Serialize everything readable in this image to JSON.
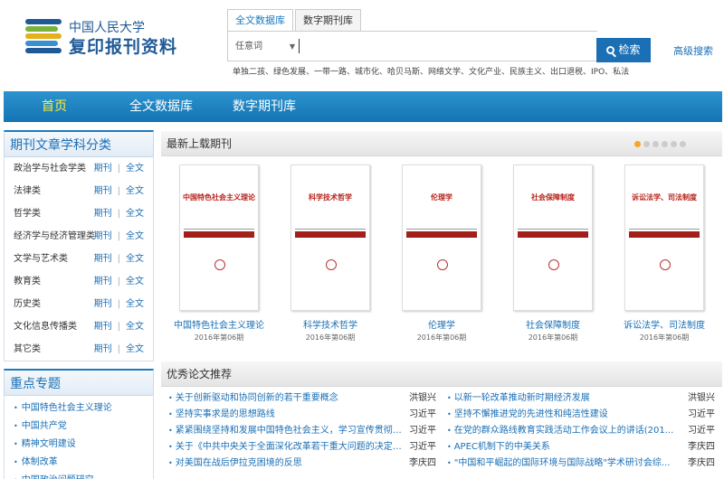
{
  "logo": {
    "line1": "中国人民大学",
    "line2": "复印报刊资料"
  },
  "colors": {
    "nav": "#1a7bc0",
    "accent": "#1a6fb5",
    "active_nav": "#ffee33",
    "cover_red": "#a3201a"
  },
  "search": {
    "tabs": [
      {
        "label": "全文数据库",
        "active": true
      },
      {
        "label": "数字期刊库",
        "active": false
      }
    ],
    "scope": "任意词",
    "button": "检索",
    "advanced": "高级搜索",
    "hot_words": "单独二孩、绿色发展、一带一路、城市化、哈贝马斯、网络文学、文化产业、民族主义、出口退税、IPO、私法"
  },
  "nav": [
    {
      "label": "首页",
      "active": true
    },
    {
      "label": "全文数据库",
      "active": false
    },
    {
      "label": "数字期刊库",
      "active": false
    }
  ],
  "sidebar": {
    "category_title": "期刊文章学科分类",
    "link_journal": "期刊",
    "link_full": "全文",
    "categories": [
      "政治学与社会学类",
      "法律类",
      "哲学类",
      "经济学与经济管理类",
      "文学与艺术类",
      "教育类",
      "历史类",
      "文化信息传播类",
      "其它类"
    ],
    "topic_title": "重点专题",
    "topics": [
      "中国特色社会主义理论",
      "中国共产党",
      "精神文明建设",
      "体制改革",
      "中国政治问题研究"
    ]
  },
  "latest": {
    "title": "最新上载期刊",
    "carousel_dots": 6,
    "active_dot": 0,
    "journals": [
      {
        "name": "中国特色社会主义理论",
        "issue": "2016年第06期"
      },
      {
        "name": "科学技术哲学",
        "issue": "2016年第06期"
      },
      {
        "name": "伦理学",
        "issue": "2016年第06期"
      },
      {
        "name": "社会保障制度",
        "issue": "2016年第06期"
      },
      {
        "name": "诉讼法学、司法制度",
        "issue": "2016年第06期"
      }
    ]
  },
  "papers": {
    "title": "优秀论文推荐",
    "left": [
      {
        "title": "关于创新驱动和协同创新的若干重要概念",
        "author": "洪银兴"
      },
      {
        "title": "坚持实事求是的思想路线",
        "author": "习近平"
      },
      {
        "title": "紧紧围绕坚持和发展中国特色社会主义，学习宣传贯彻党...",
        "author": "习近平"
      },
      {
        "title": "关于《中共中央关于全面深化改革若干重大问题的决定》...",
        "author": "习近平"
      },
      {
        "title": "对美国在战后伊拉克困境的反思",
        "author": "李庆四"
      }
    ],
    "right": [
      {
        "title": "以新一轮改革推动新时期经济发展",
        "author": "洪银兴"
      },
      {
        "title": "坚持不懈推进党的先进性和纯洁性建设",
        "author": "习近平"
      },
      {
        "title": "在党的群众路线教育实践活动工作会议上的讲话(201...",
        "author": "习近平"
      },
      {
        "title": "APEC机制下的中美关系",
        "author": "李庆四"
      },
      {
        "title": "\"中国和平崛起的国际环境与国际战略\"学术研讨会综...",
        "author": "李庆四"
      }
    ]
  }
}
